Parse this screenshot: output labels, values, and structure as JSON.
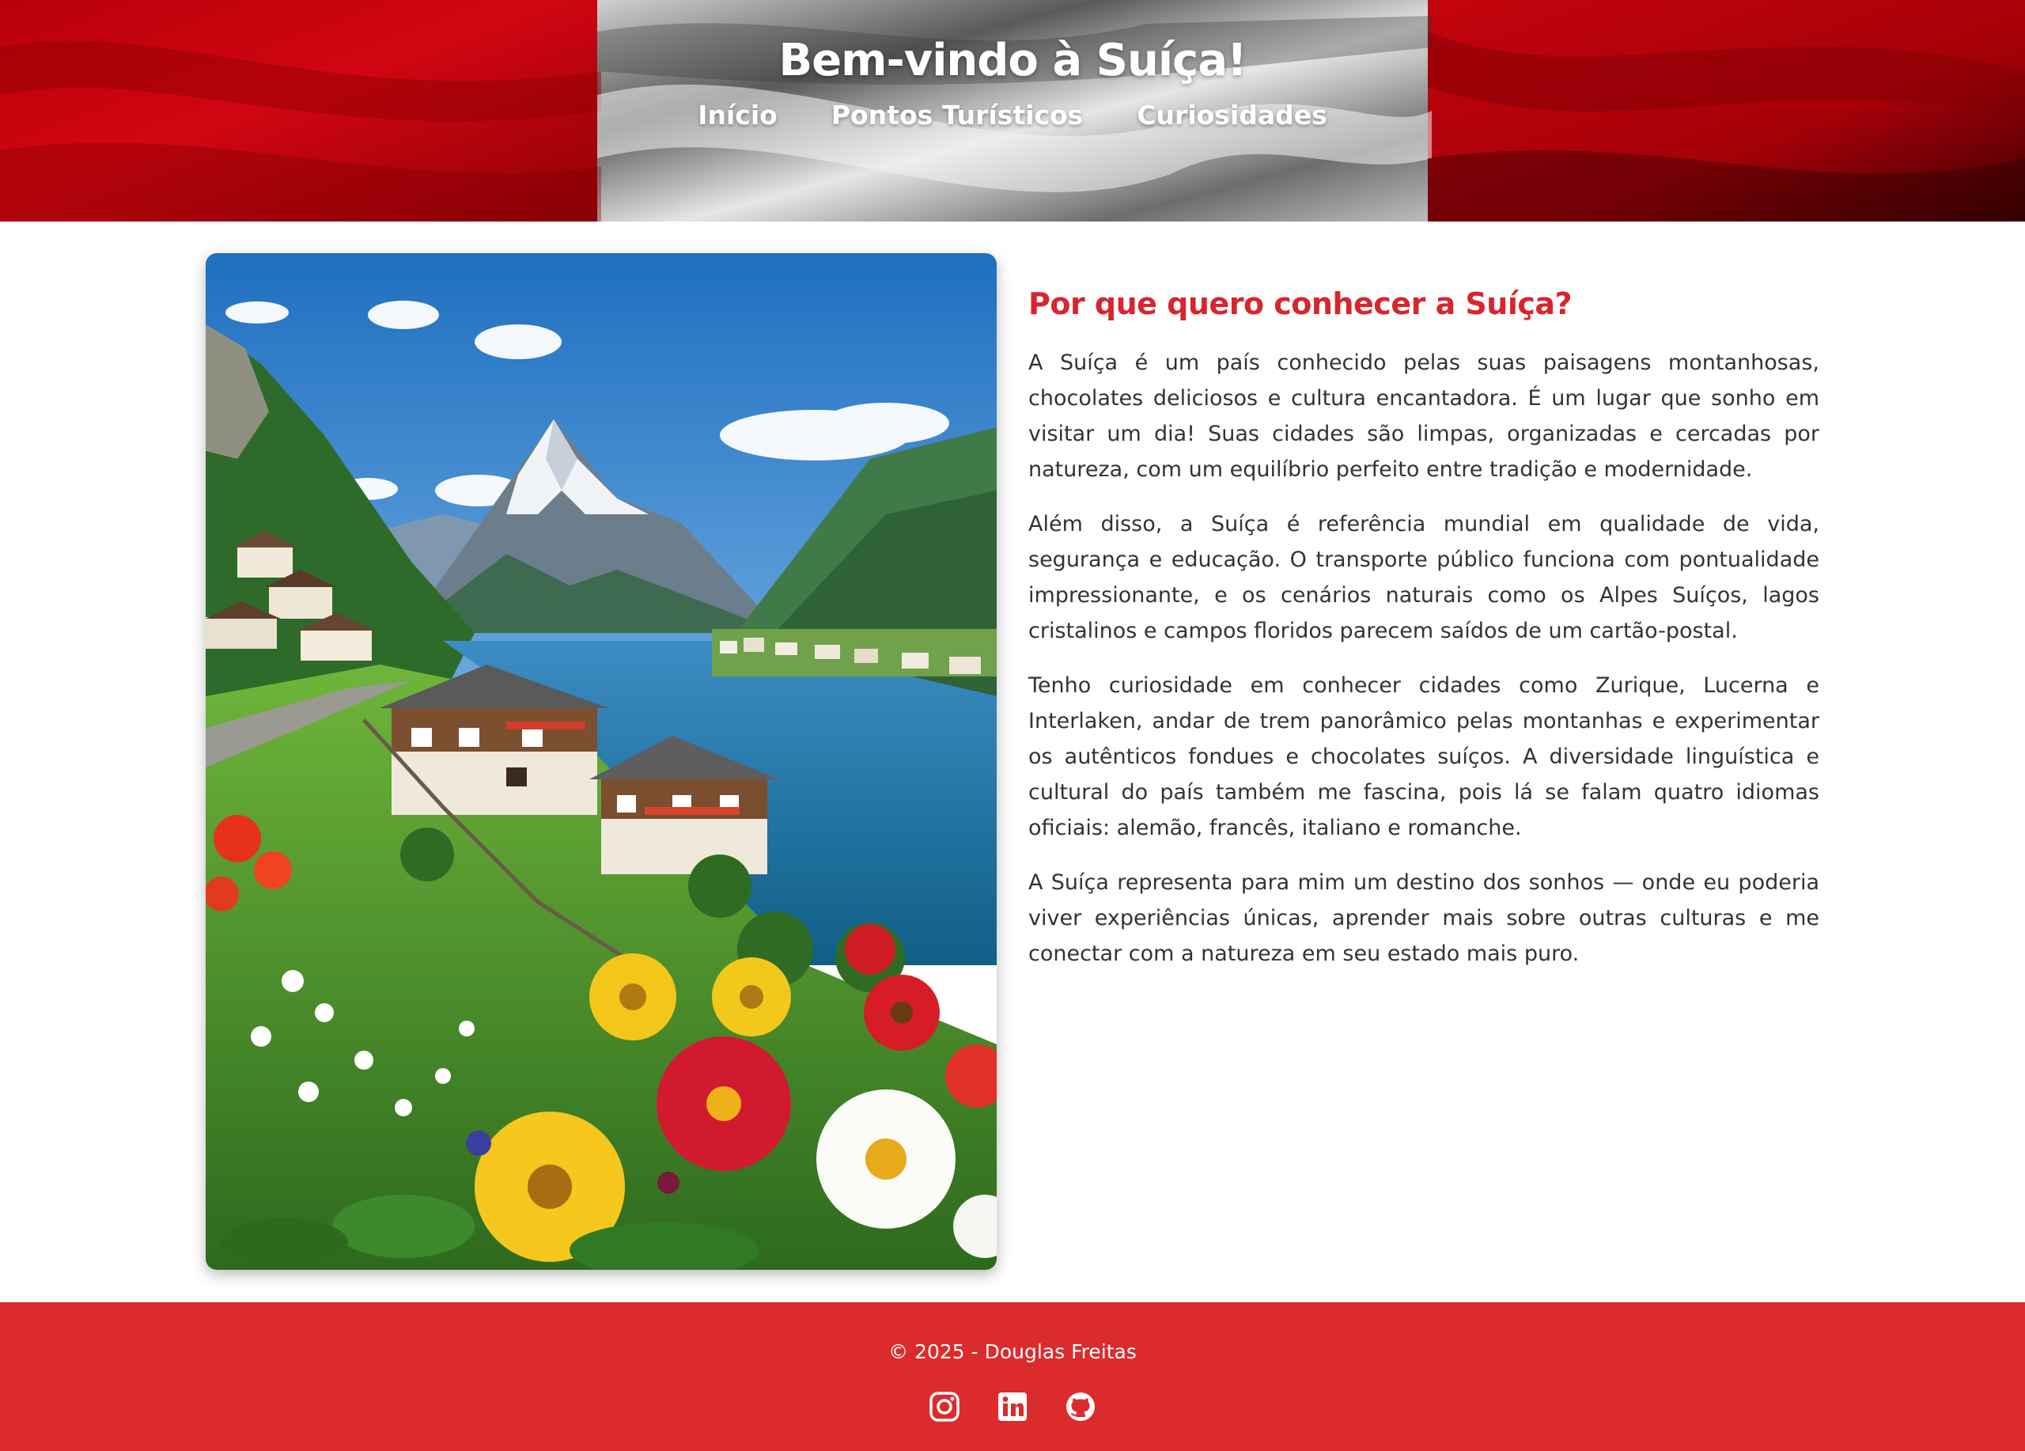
{
  "header": {
    "title": "Bem-vindo à Suíça!",
    "nav": [
      "Início",
      "Pontos Turísticos",
      "Curiosidades"
    ]
  },
  "article": {
    "heading": "Por que quero conhecer a Suíça?",
    "paragraphs": [
      "A Suíça é um país conhecido pelas suas paisagens montanhosas, chocolates deliciosos e cultura encantadora. É um lugar que sonho em visitar um dia! Suas cidades são limpas, organizadas e cercadas por natureza, com um equilíbrio perfeito entre tradição e modernidade.",
      "Além disso, a Suíça é referência mundial em qualidade de vida, segurança e educação. O transporte público funciona com pontualidade impressionante, e os cenários naturais como os Alpes Suíços, lagos cristalinos e campos floridos parecem saídos de um cartão-postal.",
      "Tenho curiosidade em conhecer cidades como Zurique, Lucerna e Interlaken, andar de trem panorâmico pelas montanhas e experimentar os autênticos fondues e chocolates suíços. A diversidade linguística e cultural do país também me fascina, pois lá se falam quatro idiomas oficiais: alemão, francês, italiano e romanche.",
      "A Suíça representa para mim um destino dos sonhos — onde eu poderia viver experiências únicas, aprender mais sobre outras culturas e me conectar com a natureza em seu estado mais puro."
    ]
  },
  "footer": {
    "copyright": "© 2025 - Douglas Freitas",
    "social_icons": [
      "instagram-icon",
      "linkedin-icon",
      "github-icon"
    ]
  },
  "colors": {
    "flag_red": "#c9070f",
    "heading_red": "#d7262d",
    "footer_red": "#dc2b2c",
    "body_text": "#333333"
  }
}
